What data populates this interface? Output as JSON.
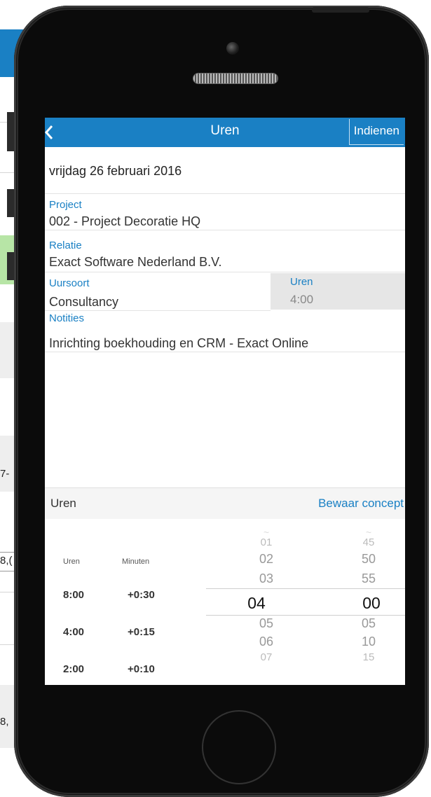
{
  "background": {
    "left_values": [
      "7-",
      "8,(",
      "8,"
    ]
  },
  "nav": {
    "title": "Uren",
    "submit_label": "Indienen"
  },
  "entry": {
    "date": "vrijdag 26 februari 2016",
    "project_label": "Project",
    "project_value": "002 - Project Decoratie HQ",
    "relation_label": "Relatie",
    "relation_value": "Exact Software Nederland B.V.",
    "type_label": "Uursoort",
    "type_value": "Consultancy",
    "hours_label": "Uren",
    "hours_value": "4:00",
    "notes_label": "Notities",
    "notes_value": "Inrichting boekhouding en CRM - Exact Online"
  },
  "picker": {
    "title": "Uren",
    "save_concept_label": "Bewaar concept",
    "quick_headers": {
      "hours": "Uren",
      "minutes": "Minuten"
    },
    "quick_rows": [
      {
        "hours": "8:00",
        "minutes": "+0:30"
      },
      {
        "hours": "4:00",
        "minutes": "+0:15"
      },
      {
        "hours": "2:00",
        "minutes": "+0:10"
      }
    ],
    "hours_wheel": [
      "01",
      "02",
      "03",
      "04",
      "05",
      "06",
      "07"
    ],
    "minutes_wheel": [
      "45",
      "50",
      "55",
      "00",
      "05",
      "10",
      "15"
    ],
    "selected_hours": "04",
    "selected_minutes": "00"
  },
  "colors": {
    "accent": "#1a80c4",
    "selection_gray": "#e6e6e6"
  }
}
